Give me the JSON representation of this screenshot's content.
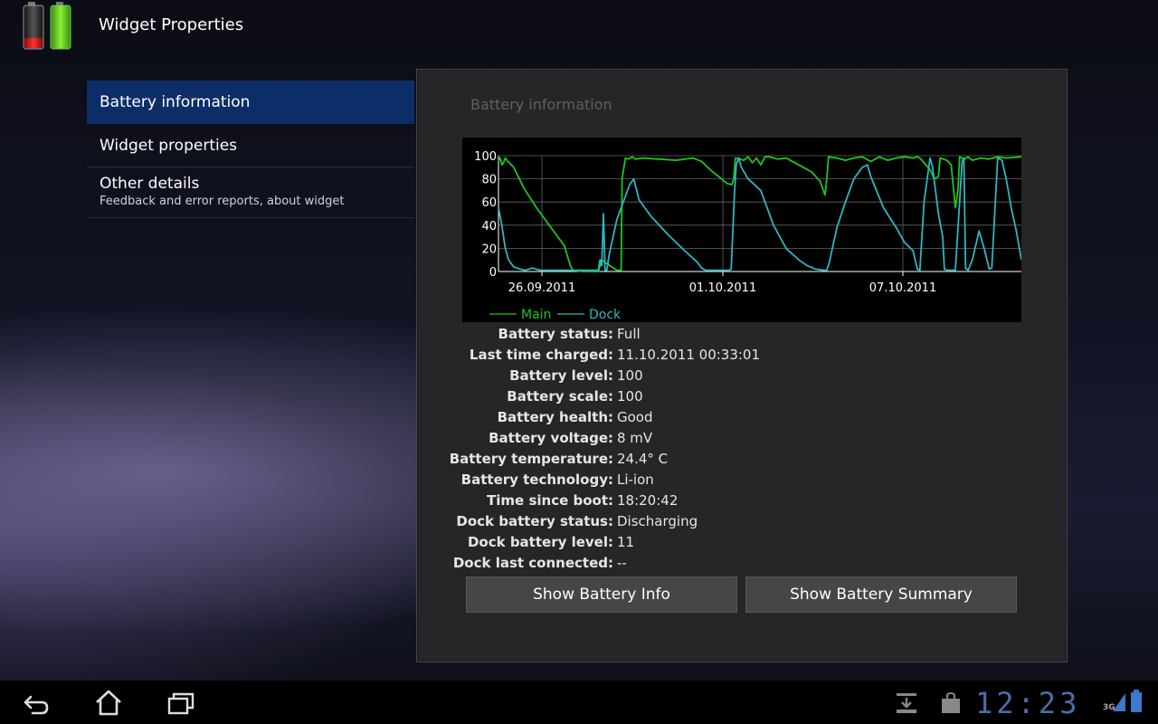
{
  "app": {
    "title": "Widget Properties",
    "icon": "battery-widget-icon"
  },
  "nav": {
    "items": [
      {
        "label": "Battery information",
        "selected": true
      },
      {
        "label": "Widget properties"
      },
      {
        "label": "Other details",
        "sublabel": "Feedback and error reports, about widget"
      }
    ]
  },
  "panel": {
    "title": "Battery information",
    "chart_data": {
      "type": "line",
      "ylim": [
        0,
        100
      ],
      "yticks": [
        "100",
        "80",
        "60",
        "40",
        "20",
        "0"
      ],
      "xticks": [
        "26.09.2011",
        "01.10.2011",
        "07.10.2011"
      ],
      "legend": {
        "position": "bottom-left"
      },
      "grid": true,
      "colors": {
        "Main": "#1ec51e",
        "Dock": "#2fb5c0"
      },
      "series": [
        {
          "name": "Main",
          "points": [
            [
              0,
              95
            ],
            [
              2,
              98
            ],
            [
              4,
              92
            ],
            [
              6,
              94
            ],
            [
              8,
              98
            ],
            [
              10,
              96
            ],
            [
              14,
              93
            ],
            [
              18,
              90
            ],
            [
              30,
              72
            ],
            [
              45,
              55
            ],
            [
              60,
              40
            ],
            [
              70,
              30
            ],
            [
              78,
              22
            ],
            [
              82,
              12
            ],
            [
              85,
              5
            ],
            [
              88,
              1
            ],
            [
              100,
              0
            ],
            [
              118,
              0
            ],
            [
              122,
              10
            ],
            [
              140,
              1
            ],
            [
              145,
              1
            ],
            [
              146,
              80
            ],
            [
              150,
              98
            ],
            [
              154,
              97
            ],
            [
              158,
              99
            ],
            [
              162,
              97
            ],
            [
              170,
              98
            ],
            [
              190,
              97
            ],
            [
              210,
              96
            ],
            [
              230,
              98
            ],
            [
              240,
              95
            ],
            [
              250,
              88
            ],
            [
              260,
              82
            ],
            [
              270,
              76
            ],
            [
              276,
              75
            ],
            [
              278,
              80
            ],
            [
              280,
              98
            ],
            [
              285,
              97
            ],
            [
              290,
              96
            ],
            [
              295,
              99
            ],
            [
              300,
              94
            ],
            [
              305,
              98
            ],
            [
              310,
              92
            ],
            [
              315,
              99
            ],
            [
              320,
              99
            ],
            [
              330,
              97
            ],
            [
              340,
              98
            ],
            [
              350,
              94
            ],
            [
              360,
              90
            ],
            [
              370,
              86
            ],
            [
              380,
              78
            ],
            [
              384,
              70
            ],
            [
              386,
              66
            ],
            [
              388,
              80
            ],
            [
              390,
              99
            ],
            [
              400,
              98
            ],
            [
              410,
              96
            ],
            [
              420,
              98
            ],
            [
              430,
              99
            ],
            [
              440,
              95
            ],
            [
              450,
              99
            ],
            [
              460,
              96
            ],
            [
              470,
              98
            ],
            [
              480,
              99
            ],
            [
              490,
              98
            ],
            [
              495,
              99
            ],
            [
              498,
              98
            ],
            [
              510,
              88
            ],
            [
              515,
              80
            ],
            [
              520,
              82
            ],
            [
              522,
              98
            ],
            [
              530,
              96
            ],
            [
              535,
              92
            ],
            [
              540,
              55
            ],
            [
              543,
              70
            ],
            [
              545,
              99
            ],
            [
              550,
              97
            ],
            [
              555,
              99
            ],
            [
              560,
              96
            ],
            [
              570,
              98
            ],
            [
              580,
              97
            ],
            [
              590,
              99
            ],
            [
              600,
              98
            ],
            [
              618,
              99
            ]
          ]
        },
        {
          "name": "Dock",
          "points": [
            [
              0,
              55
            ],
            [
              4,
              40
            ],
            [
              8,
              20
            ],
            [
              12,
              10
            ],
            [
              18,
              4
            ],
            [
              26,
              2
            ],
            [
              32,
              1
            ],
            [
              40,
              3
            ],
            [
              50,
              1
            ],
            [
              60,
              1
            ],
            [
              80,
              1
            ],
            [
              90,
              1
            ],
            [
              100,
              1
            ],
            [
              110,
              1
            ],
            [
              115,
              1
            ],
            [
              118,
              1
            ],
            [
              120,
              10
            ],
            [
              122,
              5
            ],
            [
              124,
              50
            ],
            [
              126,
              1
            ],
            [
              128,
              1
            ],
            [
              131,
              15
            ],
            [
              140,
              45
            ],
            [
              155,
              75
            ],
            [
              160,
              80
            ],
            [
              166,
              62
            ],
            [
              180,
              48
            ],
            [
              200,
              32
            ],
            [
              220,
              18
            ],
            [
              235,
              8
            ],
            [
              240,
              3
            ],
            [
              245,
              1
            ],
            [
              260,
              1
            ],
            [
              272,
              1
            ],
            [
              275,
              2
            ],
            [
              279,
              68
            ],
            [
              281,
              92
            ],
            [
              284,
              98
            ],
            [
              287,
              90
            ],
            [
              295,
              80
            ],
            [
              310,
              70
            ],
            [
              325,
              40
            ],
            [
              340,
              20
            ],
            [
              355,
              10
            ],
            [
              365,
              5
            ],
            [
              375,
              2
            ],
            [
              385,
              1
            ],
            [
              388,
              1
            ],
            [
              391,
              8
            ],
            [
              400,
              38
            ],
            [
              410,
              60
            ],
            [
              420,
              80
            ],
            [
              430,
              90
            ],
            [
              436,
              92
            ],
            [
              440,
              82
            ],
            [
              455,
              55
            ],
            [
              470,
              38
            ],
            [
              480,
              25
            ],
            [
              490,
              18
            ],
            [
              495,
              2
            ],
            [
              498,
              1
            ],
            [
              503,
              60
            ],
            [
              510,
              98
            ],
            [
              513,
              90
            ],
            [
              520,
              50
            ],
            [
              525,
              30
            ],
            [
              527,
              2
            ],
            [
              530,
              1
            ],
            [
              540,
              1
            ],
            [
              548,
              95
            ],
            [
              550,
              98
            ],
            [
              552,
              3
            ],
            [
              555,
              1
            ],
            [
              560,
              10
            ],
            [
              568,
              35
            ],
            [
              574,
              20
            ],
            [
              580,
              2
            ],
            [
              583,
              3
            ],
            [
              590,
              98
            ],
            [
              595,
              96
            ],
            [
              600,
              80
            ],
            [
              606,
              55
            ],
            [
              612,
              35
            ],
            [
              618,
              10
            ]
          ]
        }
      ]
    },
    "properties": [
      {
        "key": "Battery status:",
        "value": "Full"
      },
      {
        "key": "Last time charged:",
        "value": "11.10.2011 00:33:01"
      },
      {
        "key": "Battery level:",
        "value": "100"
      },
      {
        "key": "Battery scale:",
        "value": "100"
      },
      {
        "key": "Battery health:",
        "value": "Good"
      },
      {
        "key": "Battery voltage:",
        "value": "8 mV"
      },
      {
        "key": "Battery temperature:",
        "value": "24.4° C"
      },
      {
        "key": "Battery technology:",
        "value": "Li-ion"
      },
      {
        "key": "Time since boot:",
        "value": "18:20:42"
      },
      {
        "key": "Dock battery status:",
        "value": "Discharging"
      },
      {
        "key": "Dock battery level:",
        "value": "11"
      },
      {
        "key": "Dock last connected:",
        "value": "--"
      }
    ],
    "buttons": {
      "info": "Show Battery Info",
      "summary": "Show Battery Summary"
    }
  },
  "systembar": {
    "clock": "12:23",
    "network": "3G",
    "icons": [
      "back-icon",
      "home-icon",
      "recent-apps-icon",
      "download-notification-icon",
      "market-notification-icon",
      "signal-icon",
      "battery-status-icon"
    ]
  }
}
